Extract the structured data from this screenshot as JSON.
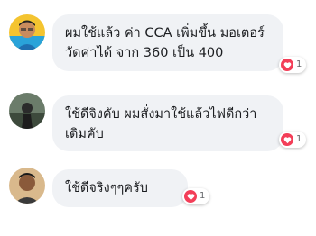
{
  "comments": [
    {
      "lines": [
        "ผมใช้แล้ว ค่า CCA เพิ่มขึ้น มอเตอร์",
        "วัดค่าได้ จาก 360 เป็น 400"
      ],
      "reaction_count": "1",
      "reaction_icon": "heart-icon"
    },
    {
      "lines": [
        "ใช้ดีจิงคับ ผมสั่งมาใช้แล้วไฟดีกว่า",
        "เดิมคับ"
      ],
      "reaction_count": "1",
      "reaction_icon": "heart-icon"
    },
    {
      "lines": [
        "ใช้ดีจริงๆๆครับ"
      ],
      "reaction_count": "1",
      "reaction_icon": "heart-icon"
    }
  ],
  "colors": {
    "bubble": "#f0f2f5",
    "heart": "#f33e58",
    "text": "#1c1e21"
  }
}
